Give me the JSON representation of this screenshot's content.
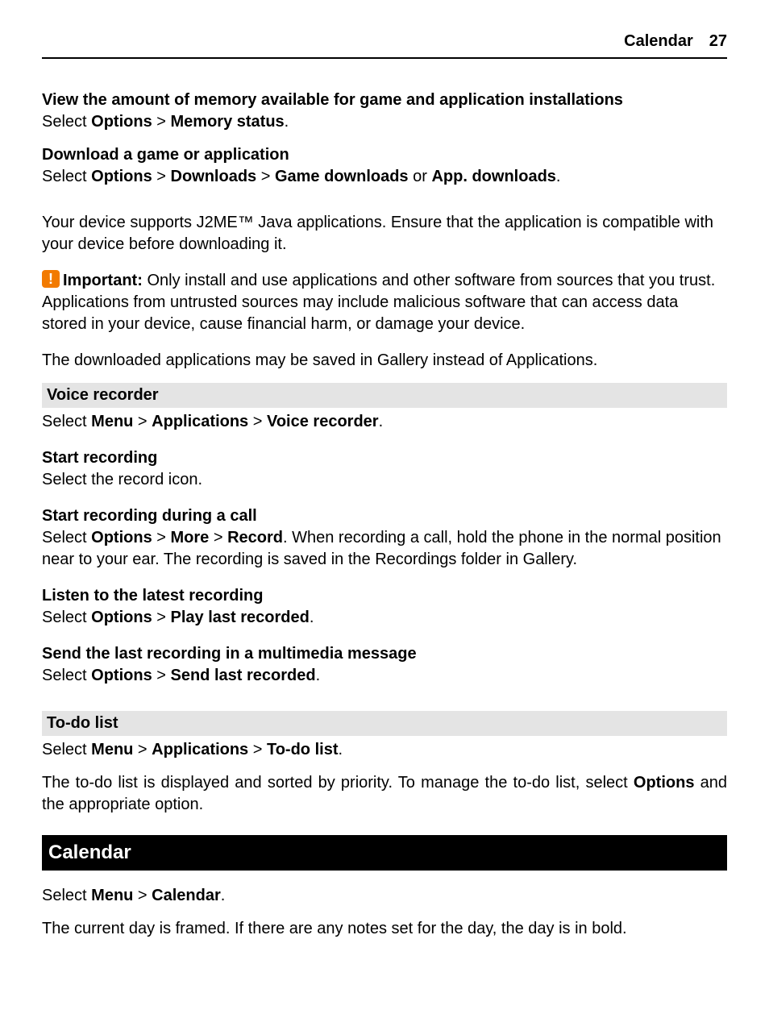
{
  "header": {
    "title": "Calendar",
    "page": "27"
  },
  "sec1": {
    "title": "View the amount of memory available for game and application installations",
    "pre": "Select ",
    "b1": "Options",
    "mid1": " > ",
    "b2": "Memory status",
    "post": "."
  },
  "sec2": {
    "title": "Download a game or application",
    "pre": "Select ",
    "b1": "Options",
    "mid1": " > ",
    "b2": "Downloads",
    "mid2": " > ",
    "b3": "Game downloads",
    "mid3": " or ",
    "b4": "App. downloads",
    "post": "."
  },
  "j2me": "Your device supports J2ME™ Java applications. Ensure that the application is compatible with your device before downloading it.",
  "important": {
    "label": "Important:",
    "text": " Only install and use applications and other software from sources that you trust. Applications from untrusted sources may include malicious software that can access data stored in your device, cause financial harm, or damage your device."
  },
  "saved": "The downloaded applications may be saved in Gallery instead of Applications.",
  "voice": {
    "title": "Voice recorder",
    "pre": "Select ",
    "b1": "Menu",
    "mid1": " > ",
    "b2": "Applications",
    "mid2": " > ",
    "b3": "Voice recorder",
    "post": "."
  },
  "startRec": {
    "title": "Start recording",
    "text": "Select the record icon."
  },
  "startCall": {
    "title": "Start recording during a call",
    "pre": "Select ",
    "b1": "Options",
    "mid1": " > ",
    "b2": "More",
    "mid2": " > ",
    "b3": "Record",
    "post": ". When recording a call, hold the phone in the normal position near to your ear. The recording is saved in the Recordings folder in Gallery."
  },
  "listen": {
    "title": "Listen to the latest recording",
    "pre": "Select ",
    "b1": "Options",
    "mid1": " > ",
    "b2": "Play last recorded",
    "post": "."
  },
  "sendLast": {
    "title": "Send the last recording in a multimedia message",
    "pre": "Select ",
    "b1": "Options",
    "mid1": " > ",
    "b2": "Send last recorded",
    "post": "."
  },
  "todo": {
    "title": "To-do list",
    "pre": "Select ",
    "b1": "Menu",
    "mid1": " > ",
    "b2": "Applications",
    "mid2": " > ",
    "b3": "To-do list",
    "post": ".",
    "desc_pre": "The to-do list is displayed and sorted by priority. To manage the to-do list, select ",
    "desc_b": "Options",
    "desc_post": " and the appropriate option."
  },
  "calendar": {
    "title": "Calendar",
    "pre": "Select ",
    "b1": "Menu",
    "mid1": " > ",
    "b2": "Calendar",
    "post": ".",
    "desc": "The current day is framed. If there are any notes set for the day, the day is in bold."
  }
}
